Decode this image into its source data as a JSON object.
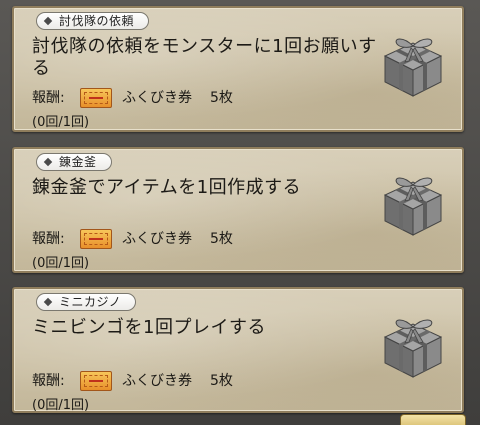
{
  "quests": [
    {
      "category": "討伐隊の依頼",
      "title": "討伐隊の依頼をモンスターに1回お願いする",
      "reward_label": "報酬:",
      "reward_name": "ふくびき券",
      "reward_count": "5枚",
      "progress": "(0回/1回)",
      "icon": "gift-box-icon"
    },
    {
      "category": "錬金釜",
      "title": "錬金釜でアイテムを1回作成する",
      "reward_label": "報酬:",
      "reward_name": "ふくびき券",
      "reward_count": "5枚",
      "progress": "(0回/1回)",
      "icon": "gift-box-icon"
    },
    {
      "category": "ミニカジノ",
      "title": "ミニビンゴを1回プレイする",
      "reward_label": "報酬:",
      "reward_name": "ふくびき券",
      "reward_count": "5枚",
      "progress": "(0回/1回)",
      "icon": "gift-box-icon"
    }
  ],
  "colors": {
    "card_bg": "#cdc2a7",
    "card_border": "#8f7d5c",
    "ticket": "#f0a83c",
    "gift": "#7b7b7b"
  }
}
